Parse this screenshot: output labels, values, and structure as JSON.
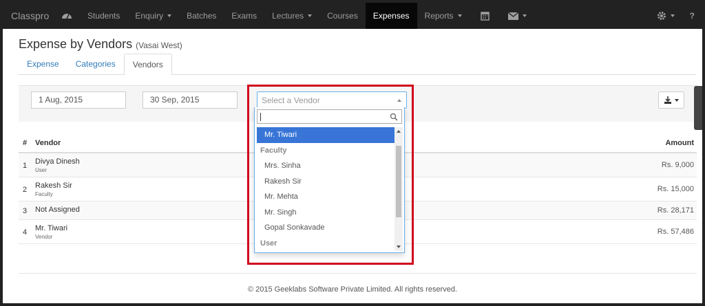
{
  "navbar": {
    "brand": "Classpro",
    "items": [
      {
        "label": "Students"
      },
      {
        "label": "Enquiry",
        "caret": true
      },
      {
        "label": "Batches"
      },
      {
        "label": "Exams"
      },
      {
        "label": "Lectures",
        "caret": true
      },
      {
        "label": "Courses"
      },
      {
        "label": "Expenses",
        "active": true
      },
      {
        "label": "Reports",
        "caret": true
      }
    ],
    "help": "?"
  },
  "page": {
    "title": "Expense by Vendors",
    "subtitle": "(Vasai West)"
  },
  "tabs": [
    {
      "label": "Expense"
    },
    {
      "label": "Categories"
    },
    {
      "label": "Vendors",
      "active": true
    }
  ],
  "filters": {
    "date_from": "1 Aug, 2015",
    "date_to": "30 Sep, 2015",
    "vendor_placeholder": "Select a Vendor"
  },
  "table": {
    "headers": {
      "num": "#",
      "vendor": "Vendor",
      "amount": "Amount"
    },
    "rows": [
      {
        "num": "1",
        "vendor": "Divya Dinesh",
        "type": "User",
        "amount": "Rs. 9,000"
      },
      {
        "num": "2",
        "vendor": "Rakesh Sir",
        "type": "Faculty",
        "amount": "Rs. 15,000"
      },
      {
        "num": "3",
        "vendor": "Not Assigned",
        "type": "",
        "amount": "Rs. 28,171"
      },
      {
        "num": "4",
        "vendor": "Mr. Tiwari",
        "type": "Vendor",
        "amount": "Rs. 57,486"
      }
    ]
  },
  "dropdown": {
    "search_value": "",
    "options": [
      {
        "label": "Mr. Tiwari",
        "highlighted": true
      },
      {
        "label": "Faculty",
        "group": true
      },
      {
        "label": "Mrs. Sinha"
      },
      {
        "label": "Rakesh Sir"
      },
      {
        "label": "Mr. Mehta"
      },
      {
        "label": "Mr. Singh"
      },
      {
        "label": "Gopal Sonkavade"
      },
      {
        "label": "User",
        "group": true
      }
    ]
  },
  "footer": {
    "text": "© 2015 Geeklabs Software Private Limited. All rights reserved."
  },
  "colors": {
    "navbar_bg": "#222222",
    "highlight_frame": "#d0021b",
    "option_highlight": "#3875d7",
    "link": "#337ab7"
  }
}
